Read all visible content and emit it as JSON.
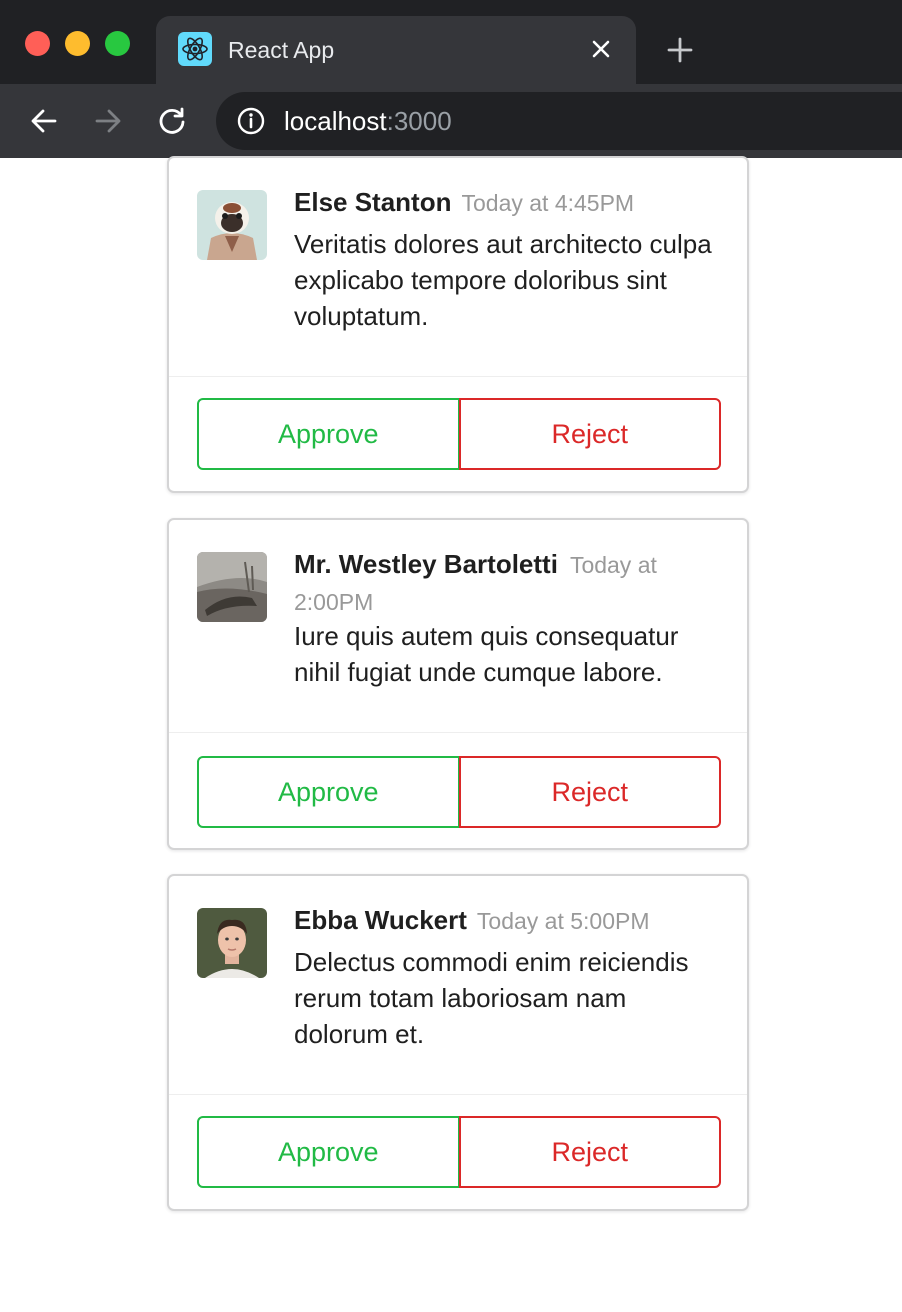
{
  "browser": {
    "tab_title": "React App",
    "url_host": "localhost",
    "url_port": ":3000",
    "icons": {
      "favicon": "react-icon",
      "close": "close-icon",
      "new_tab": "plus-icon",
      "back": "back-arrow-icon",
      "forward": "forward-arrow-icon",
      "reload": "reload-icon",
      "info": "info-icon"
    }
  },
  "colors": {
    "approve": "#21ba45",
    "reject": "#db2828",
    "timestamp": "#999999"
  },
  "comments": [
    {
      "author": "Else Stanton",
      "date": "Today at 4:45PM",
      "text": "Veritatis dolores aut architecto culpa explicabo tempore doloribus sint voluptatum.",
      "approve_label": "Approve",
      "reject_label": "Reject"
    },
    {
      "author": "Mr. Westley Bartoletti",
      "date": "Today at 2:00PM",
      "text": "Iure quis autem quis consequatur nihil fugiat unde cumque labore.",
      "approve_label": "Approve",
      "reject_label": "Reject"
    },
    {
      "author": "Ebba Wuckert",
      "date": "Today at 5:00PM",
      "text": "Delectus commodi enim reiciendis rerum totam laboriosam nam dolorum et.",
      "approve_label": "Approve",
      "reject_label": "Reject"
    }
  ]
}
